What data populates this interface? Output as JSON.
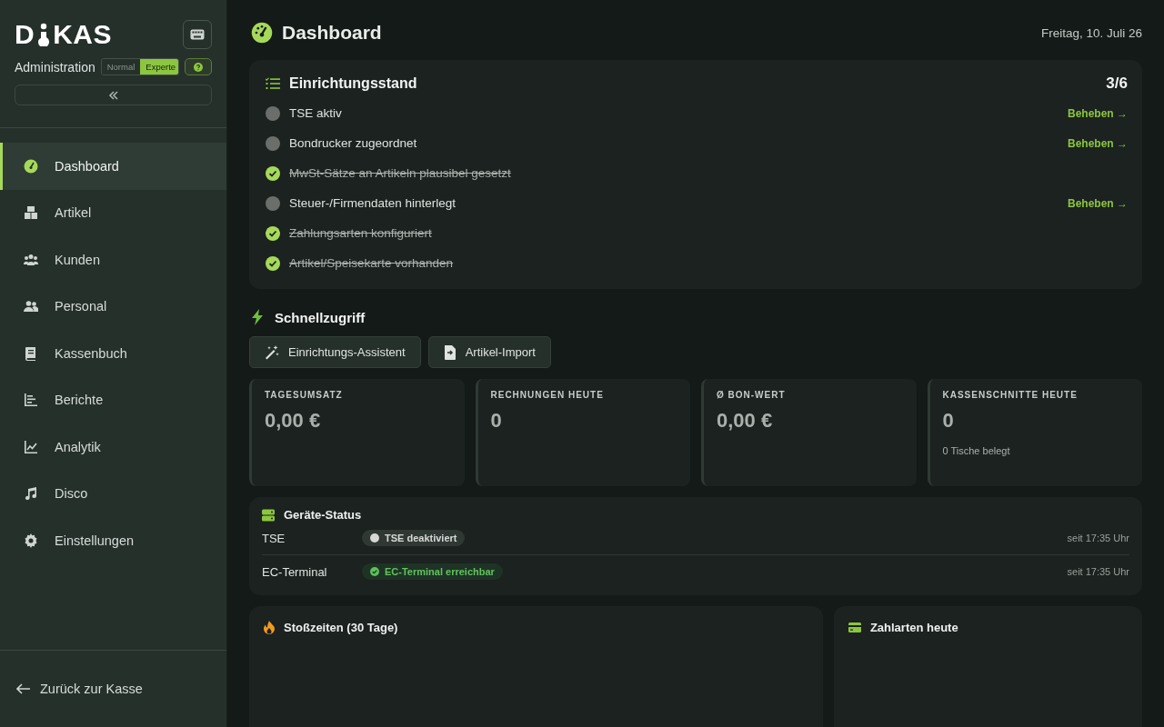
{
  "sidebar": {
    "logo": {
      "left": "D",
      "right": "KAS"
    },
    "subtitle": "Administration",
    "modes": [
      {
        "label": "Normal",
        "selected": false
      },
      {
        "label": "Experte",
        "selected": true
      }
    ],
    "items": [
      {
        "label": "Dashboard",
        "selected": true
      },
      {
        "label": "Artikel",
        "selected": false
      },
      {
        "label": "Kunden",
        "selected": false
      },
      {
        "label": "Personal",
        "selected": false
      },
      {
        "label": "Kassenbuch",
        "selected": false
      },
      {
        "label": "Berichte",
        "selected": false
      },
      {
        "label": "Analytik",
        "selected": false
      },
      {
        "label": "Disco",
        "selected": false
      },
      {
        "label": "Einstellungen",
        "selected": false
      }
    ],
    "back": "Zurück zur Kasse"
  },
  "header": {
    "title": "Dashboard",
    "date": "Freitag, 10. Juli 26"
  },
  "setup": {
    "title": "Einrichtungsstand",
    "count": "3/6",
    "items": [
      {
        "label": "TSE aktiv",
        "done": false,
        "action": "Beheben →"
      },
      {
        "label": "Bondrucker zugeordnet",
        "done": false,
        "action": "Beheben →"
      },
      {
        "label": "MwSt-Sätze an Artikeln plausibel gesetzt",
        "done": true
      },
      {
        "label": "Steuer-/Firmendaten hinterlegt",
        "done": false,
        "action": "Beheben →"
      },
      {
        "label": "Zahlungsarten konfiguriert",
        "done": true
      },
      {
        "label": "Artikel/Speisekarte vorhanden",
        "done": true
      }
    ]
  },
  "quick": {
    "title": "Schnellzugriff",
    "buttons": [
      "Einrichtungs-Assistent",
      "Artikel-Import"
    ]
  },
  "stats": [
    {
      "label": "TAGESUMSATZ",
      "value": "0,00 €"
    },
    {
      "label": "RECHNUNGEN HEUTE",
      "value": "0"
    },
    {
      "label": "Ø BON-WERT",
      "value": "0,00 €"
    },
    {
      "label": "KASSENSCHNITTE HEUTE",
      "value": "0",
      "note": "0 Tische belegt"
    }
  ],
  "devices": {
    "title": "Geräte-Status",
    "rows": [
      {
        "name": "TSE",
        "status": "TSE deaktiviert",
        "kind": "off",
        "since": "seit 17:35 Uhr"
      },
      {
        "name": "EC-Terminal",
        "status": "EC-Terminal erreichbar",
        "kind": "ok",
        "since": "seit 17:35 Uhr"
      }
    ]
  },
  "panels": [
    {
      "title": "Stoßzeiten (30 Tage)"
    },
    {
      "title": "Zahlarten heute"
    }
  ]
}
